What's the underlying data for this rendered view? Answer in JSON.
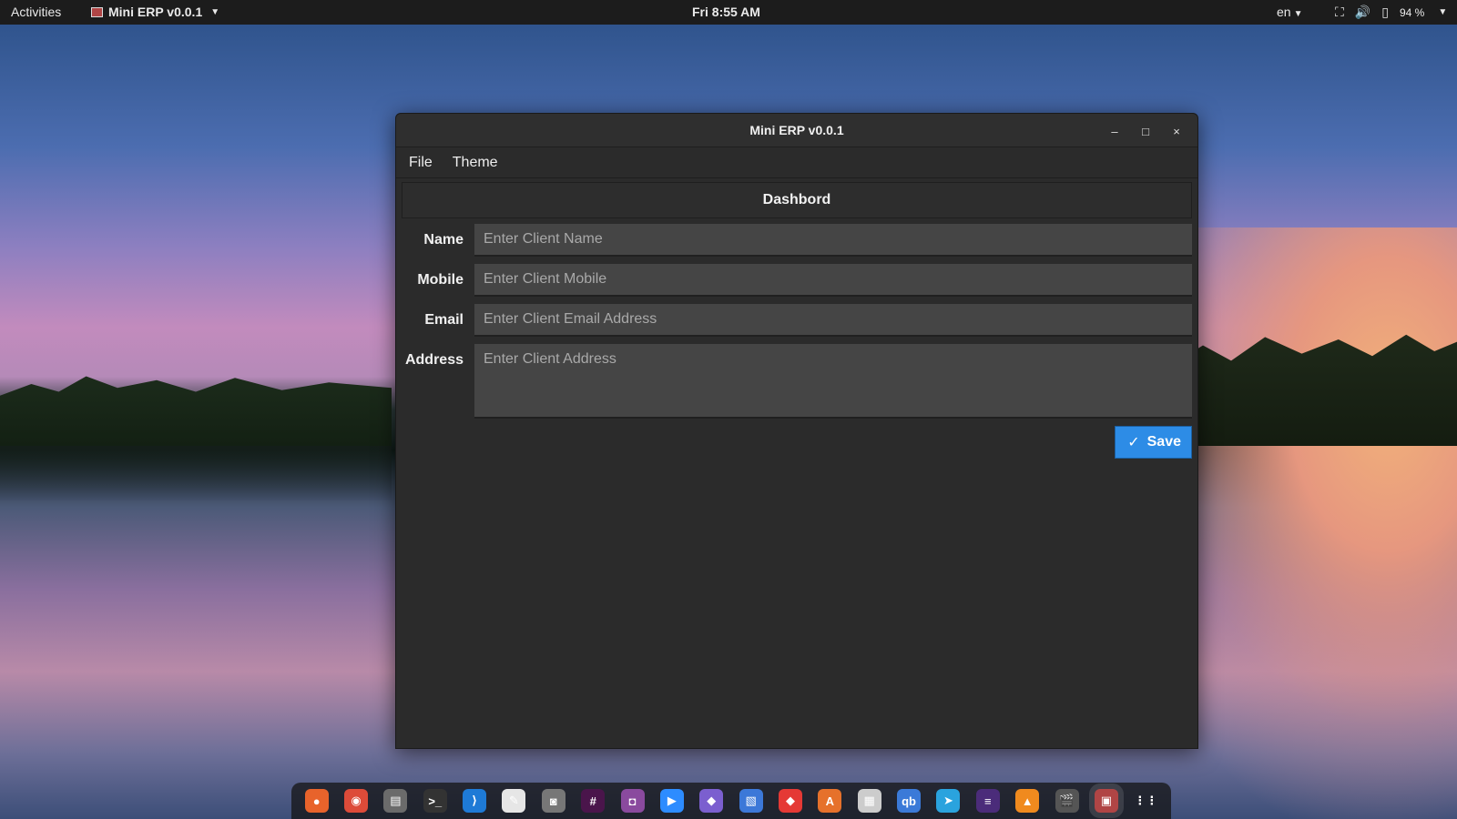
{
  "topbar": {
    "activities": "Activities",
    "app_name": "Mini ERP v0.0.1",
    "clock": "Fri  8:55 AM",
    "language": "en",
    "battery": "94 %"
  },
  "window": {
    "title": "Mini ERP v0.0.1",
    "minimize_icon": "–",
    "maximize_icon": "□",
    "close_icon": "×"
  },
  "menu": {
    "file": "File",
    "theme": "Theme"
  },
  "dashboard": {
    "header": "Dashbord"
  },
  "form": {
    "name_label": "Name",
    "name_placeholder": "Enter Client Name",
    "mobile_label": "Mobile",
    "mobile_placeholder": "Enter Client Mobile",
    "email_label": "Email",
    "email_placeholder": "Enter Client Email Address",
    "address_label": "Address",
    "address_placeholder": "Enter Client Address",
    "save_label": "Save"
  },
  "dock": {
    "items": [
      {
        "name": "firefox-icon",
        "color": "#e8632b",
        "glyph": "●"
      },
      {
        "name": "chrome-icon",
        "color": "#dd4b39",
        "glyph": "◉"
      },
      {
        "name": "files-icon",
        "color": "#6b6b6b",
        "glyph": "▤"
      },
      {
        "name": "terminal-icon",
        "color": "#333333",
        "glyph": ">_"
      },
      {
        "name": "vscode-icon",
        "color": "#1e7ad6",
        "glyph": "⟩"
      },
      {
        "name": "text-editor-icon",
        "color": "#e6e6e6",
        "glyph": "✎"
      },
      {
        "name": "screenshot-icon",
        "color": "#777777",
        "glyph": "◙"
      },
      {
        "name": "slack-icon",
        "color": "#4a154b",
        "glyph": "#"
      },
      {
        "name": "video-recorder-icon",
        "color": "#8a4a9e",
        "glyph": "◘"
      },
      {
        "name": "zoom-icon",
        "color": "#2d8cff",
        "glyph": "▶"
      },
      {
        "name": "obsidian-icon",
        "color": "#7b5fcf",
        "glyph": "◆"
      },
      {
        "name": "document-viewer-icon",
        "color": "#3c78d8",
        "glyph": "▧"
      },
      {
        "name": "anydesk-icon",
        "color": "#e53935",
        "glyph": "◆"
      },
      {
        "name": "software-store-icon",
        "color": "#e6712b",
        "glyph": "A"
      },
      {
        "name": "calculator-icon",
        "color": "#cccccc",
        "glyph": "▦"
      },
      {
        "name": "qbittorrent-icon",
        "color": "#3b7ad8",
        "glyph": "qb"
      },
      {
        "name": "telegram-icon",
        "color": "#2aa3de",
        "glyph": "➤"
      },
      {
        "name": "kdenlive-icon",
        "color": "#4b2c7a",
        "glyph": "≡"
      },
      {
        "name": "vlc-icon",
        "color": "#f08a1e",
        "glyph": "▲"
      },
      {
        "name": "video-editor-icon",
        "color": "#555555",
        "glyph": "🎬"
      },
      {
        "name": "mini-erp-icon",
        "color": "#b04545",
        "glyph": "▣"
      },
      {
        "name": "show-apps-icon",
        "color": "transparent",
        "glyph": "⋮⋮"
      }
    ]
  }
}
